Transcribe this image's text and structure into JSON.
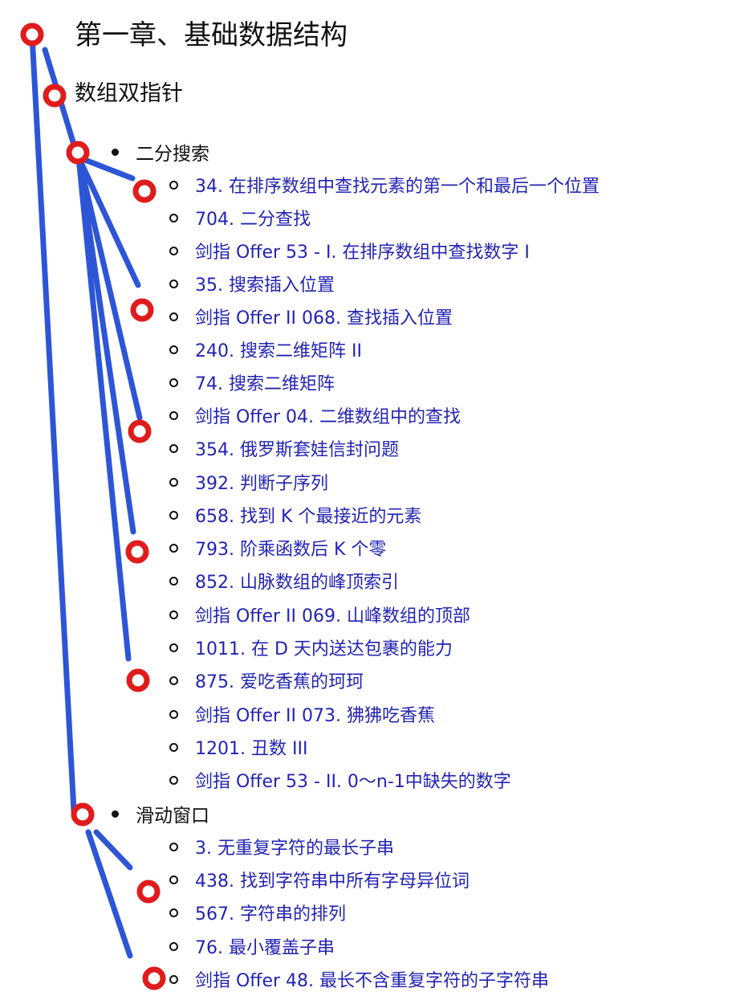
{
  "title": "第一章、基础数据结构",
  "subtitle": "数组双指针",
  "sections": [
    {
      "label": "二分搜索",
      "items": [
        "34. 在排序数组中查找元素的第一个和最后一个位置",
        "704. 二分查找",
        "剑指 Offer 53 - I. 在排序数组中查找数字 I",
        "35. 搜索插入位置",
        "剑指 Offer II 068. 查找插入位置",
        "240. 搜索二维矩阵 II",
        "74. 搜索二维矩阵",
        "剑指 Offer 04. 二维数组中的查找",
        "354. 俄罗斯套娃信封问题",
        "392. 判断子序列",
        "658. 找到 K 个最接近的元素",
        "793. 阶乘函数后 K 个零",
        "852. 山脉数组的峰顶索引",
        "剑指 Offer II 069. 山峰数组的顶部",
        "1011. 在 D 天内送达包裹的能力",
        "875. 爱吃香蕉的珂珂",
        "剑指 Offer II 073. 狒狒吃香蕉",
        "1201. 丑数 III",
        "剑指 Offer 53 - II. 0～n-1中缺失的数字"
      ]
    },
    {
      "label": "滑动窗口",
      "items": [
        "3. 无重复字符的最长子串",
        "438. 找到字符串中所有字母异位词",
        "567. 字符串的排列",
        "76. 最小覆盖子串",
        "剑指 Offer 48. 最长不含重复字符的子字符串"
      ]
    }
  ],
  "colors": {
    "link": "#2323b4",
    "text": "#111111",
    "annotation_line": "#2d55d6",
    "annotation_circle": "#e01b1b"
  }
}
